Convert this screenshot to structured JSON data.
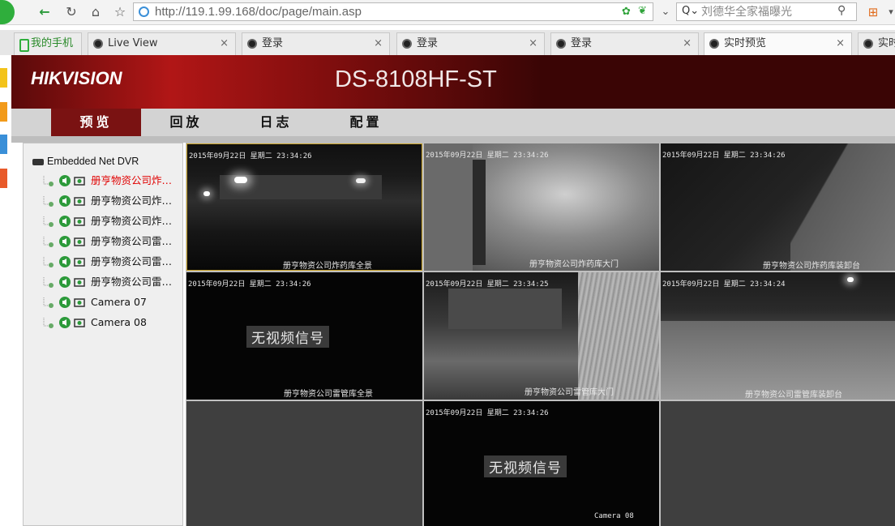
{
  "browser": {
    "url": "http://119.1.99.168/doc/page/main.asp",
    "search_placeholder": "刘德华全家福曝光",
    "tabs": [
      {
        "label": "我的手机"
      },
      {
        "label": "Live View"
      },
      {
        "label": "登录"
      },
      {
        "label": "登录"
      },
      {
        "label": "登录"
      },
      {
        "label": "实时预览"
      },
      {
        "label": "实时"
      }
    ]
  },
  "app": {
    "brand": "HIKVISION",
    "model": "DS-8108HF-ST",
    "menu": [
      {
        "label": "预览",
        "active": true
      },
      {
        "label": "回放"
      },
      {
        "label": "日志"
      },
      {
        "label": "配置"
      }
    ]
  },
  "tree": {
    "root": "Embedded Net DVR",
    "cameras": [
      {
        "label": "册亨物资公司炸药...",
        "selected": true
      },
      {
        "label": "册亨物资公司炸药..."
      },
      {
        "label": "册亨物资公司炸药..."
      },
      {
        "label": "册亨物资公司雷管..."
      },
      {
        "label": "册亨物资公司雷管..."
      },
      {
        "label": "册亨物资公司雷管..."
      },
      {
        "label": "Camera 07"
      },
      {
        "label": "Camera 08"
      }
    ]
  },
  "video": {
    "timestamp_a": "2015年09月22日 星期二 23:34:26",
    "timestamp_b": "2015年09月22日 星期二 23:34:25",
    "timestamp_c": "2015年09月22日 星期二 23:34:24",
    "no_signal": "无视频信号",
    "names": {
      "c1": "册亨物资公司炸药库全景",
      "c2": "册亨物资公司炸药库大门",
      "c3": "册亨物资公司炸药库装卸台",
      "c4": "册亨物资公司雷管库全景",
      "c5": "册亨物资公司雷管库大门",
      "c6": "册亨物资公司雷管库装卸台",
      "c8": "Camera 08"
    }
  },
  "colors": {
    "selected_text": "#e00000",
    "menu_active": "#7a1212",
    "banner_red": "#b11616",
    "selected_cell_border": "#c9a227"
  }
}
